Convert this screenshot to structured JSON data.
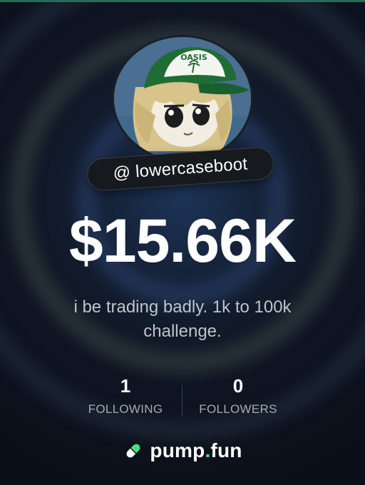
{
  "profile": {
    "handle": "@ lowercaseboot",
    "balance": "$15.66K",
    "bio": "i be trading badly. 1k to 100k challenge.",
    "avatar_cap_text": "OASIS"
  },
  "stats": {
    "following": {
      "value": "1",
      "label": "FOLLOWING"
    },
    "followers": {
      "value": "0",
      "label": "FOLLOWERS"
    }
  },
  "brand": {
    "name_part1": "pump",
    "dot": ".",
    "name_part2": "fun",
    "icon": "pill-icon",
    "accent_color": "#4ade80"
  },
  "colors": {
    "background": "#0e1116",
    "text_primary": "#ffffff",
    "text_secondary": "#bfc4c9"
  }
}
